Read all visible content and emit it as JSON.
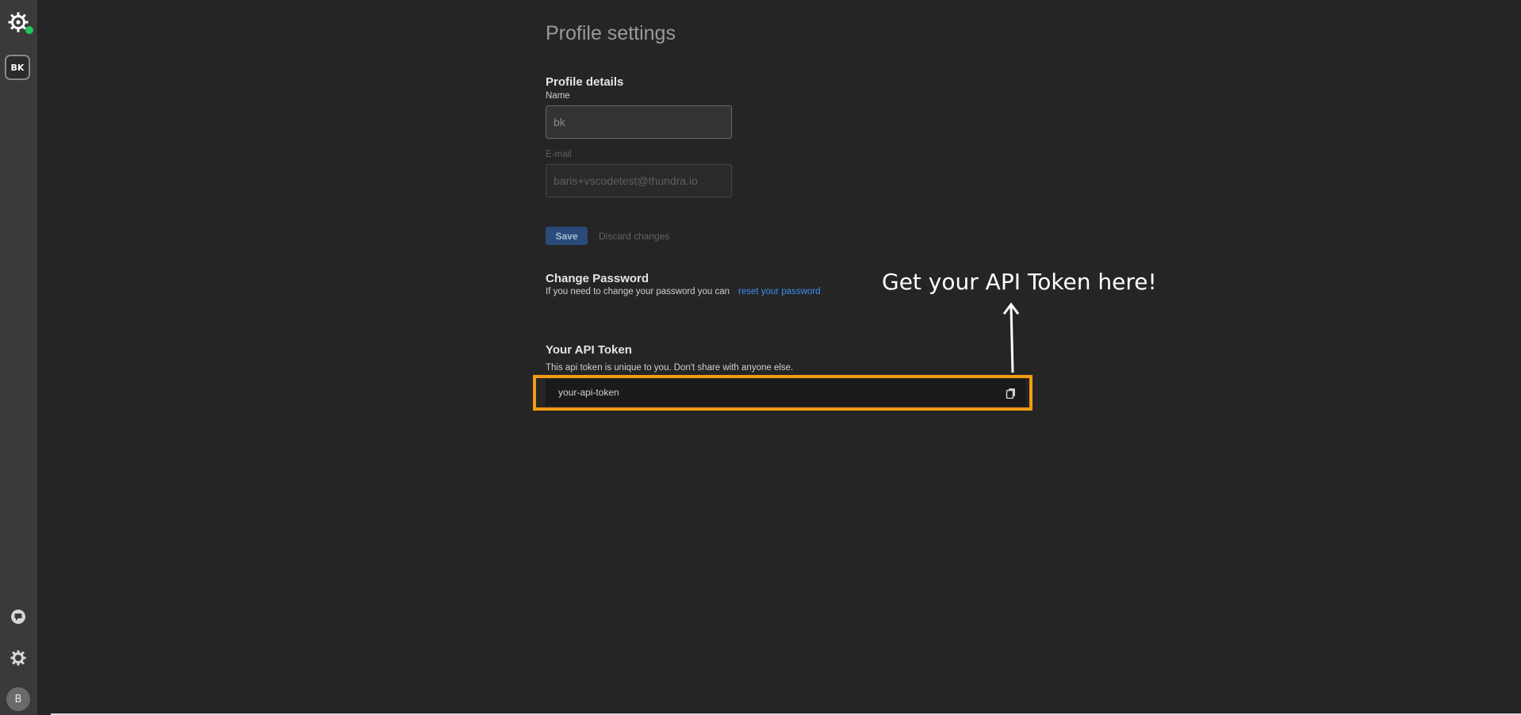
{
  "sidebar": {
    "logo_icon": "settings-logo-icon",
    "workspace_label": "BK",
    "icons": [
      "chat-icon",
      "gear-icon"
    ],
    "avatar_label": "B",
    "status_color": "#21c55d"
  },
  "page": {
    "title": "Profile settings"
  },
  "profile": {
    "section_title": "Profile details",
    "name_label": "Name",
    "name_value": "bk",
    "email_label": "E-mail",
    "email_value": "baris+vscodetest@thundra.io",
    "save_label": "Save",
    "discard_label": "Discard changes"
  },
  "password": {
    "section_title": "Change Password",
    "description": "If you need to change your password you can",
    "link_label": "reset your password"
  },
  "api_token": {
    "section_title": "Your API Token",
    "description": "This api token is unique to you. Don't share with anyone else.",
    "value": "your-api-token",
    "copy_icon": "copy-icon",
    "highlight_color": "#f39c12"
  },
  "annotation": {
    "text": "Get your API Token here!"
  }
}
